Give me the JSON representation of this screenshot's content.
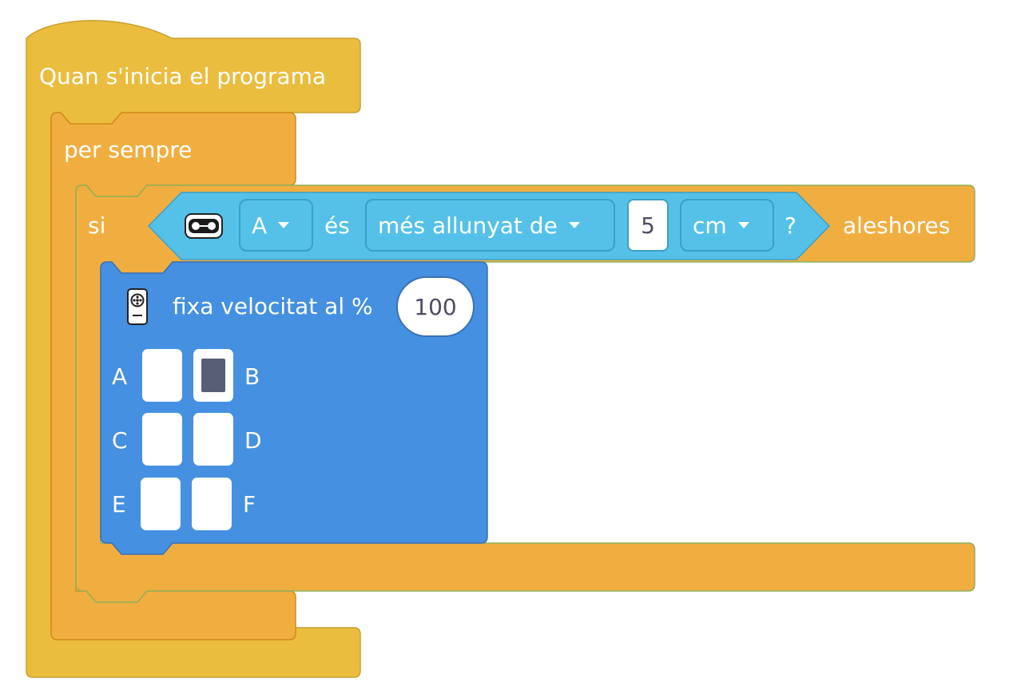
{
  "blocks": {
    "start": {
      "label": "Quan s'inicia el programa"
    },
    "forever": {
      "label": "per sempre"
    },
    "if_block": {
      "si_label": "si",
      "then_label": "aleshores",
      "condition": {
        "sensor_icon": "distance-sensor-icon",
        "port_value": "A",
        "es_label": "és",
        "comparison_value": "més allunyat de",
        "distance_value": "5",
        "unit_value": "cm",
        "question_mark": "?"
      }
    },
    "set_speed": {
      "motor_icon": "motor-icon",
      "label": "fixa velocitat al %",
      "speed_value": "100",
      "ports": [
        {
          "label": "A",
          "selected": false
        },
        {
          "label": "B",
          "selected": true
        },
        {
          "label": "C",
          "selected": false
        },
        {
          "label": "D",
          "selected": false
        },
        {
          "label": "E",
          "selected": false
        },
        {
          "label": "F",
          "selected": false
        }
      ]
    }
  },
  "colors": {
    "event_yellow": "#ebbd3f",
    "event_yellow_border": "#c9a12e",
    "control_orange": "#f1ae40",
    "control_orange_border": "#cf8b17",
    "control_outline_green": "#8db05a",
    "sensor_cyan": "#55c1e9",
    "sensor_cyan_border": "#3aa0c8",
    "motor_blue": "#4590e0",
    "motor_blue_border": "#3a70b8"
  }
}
